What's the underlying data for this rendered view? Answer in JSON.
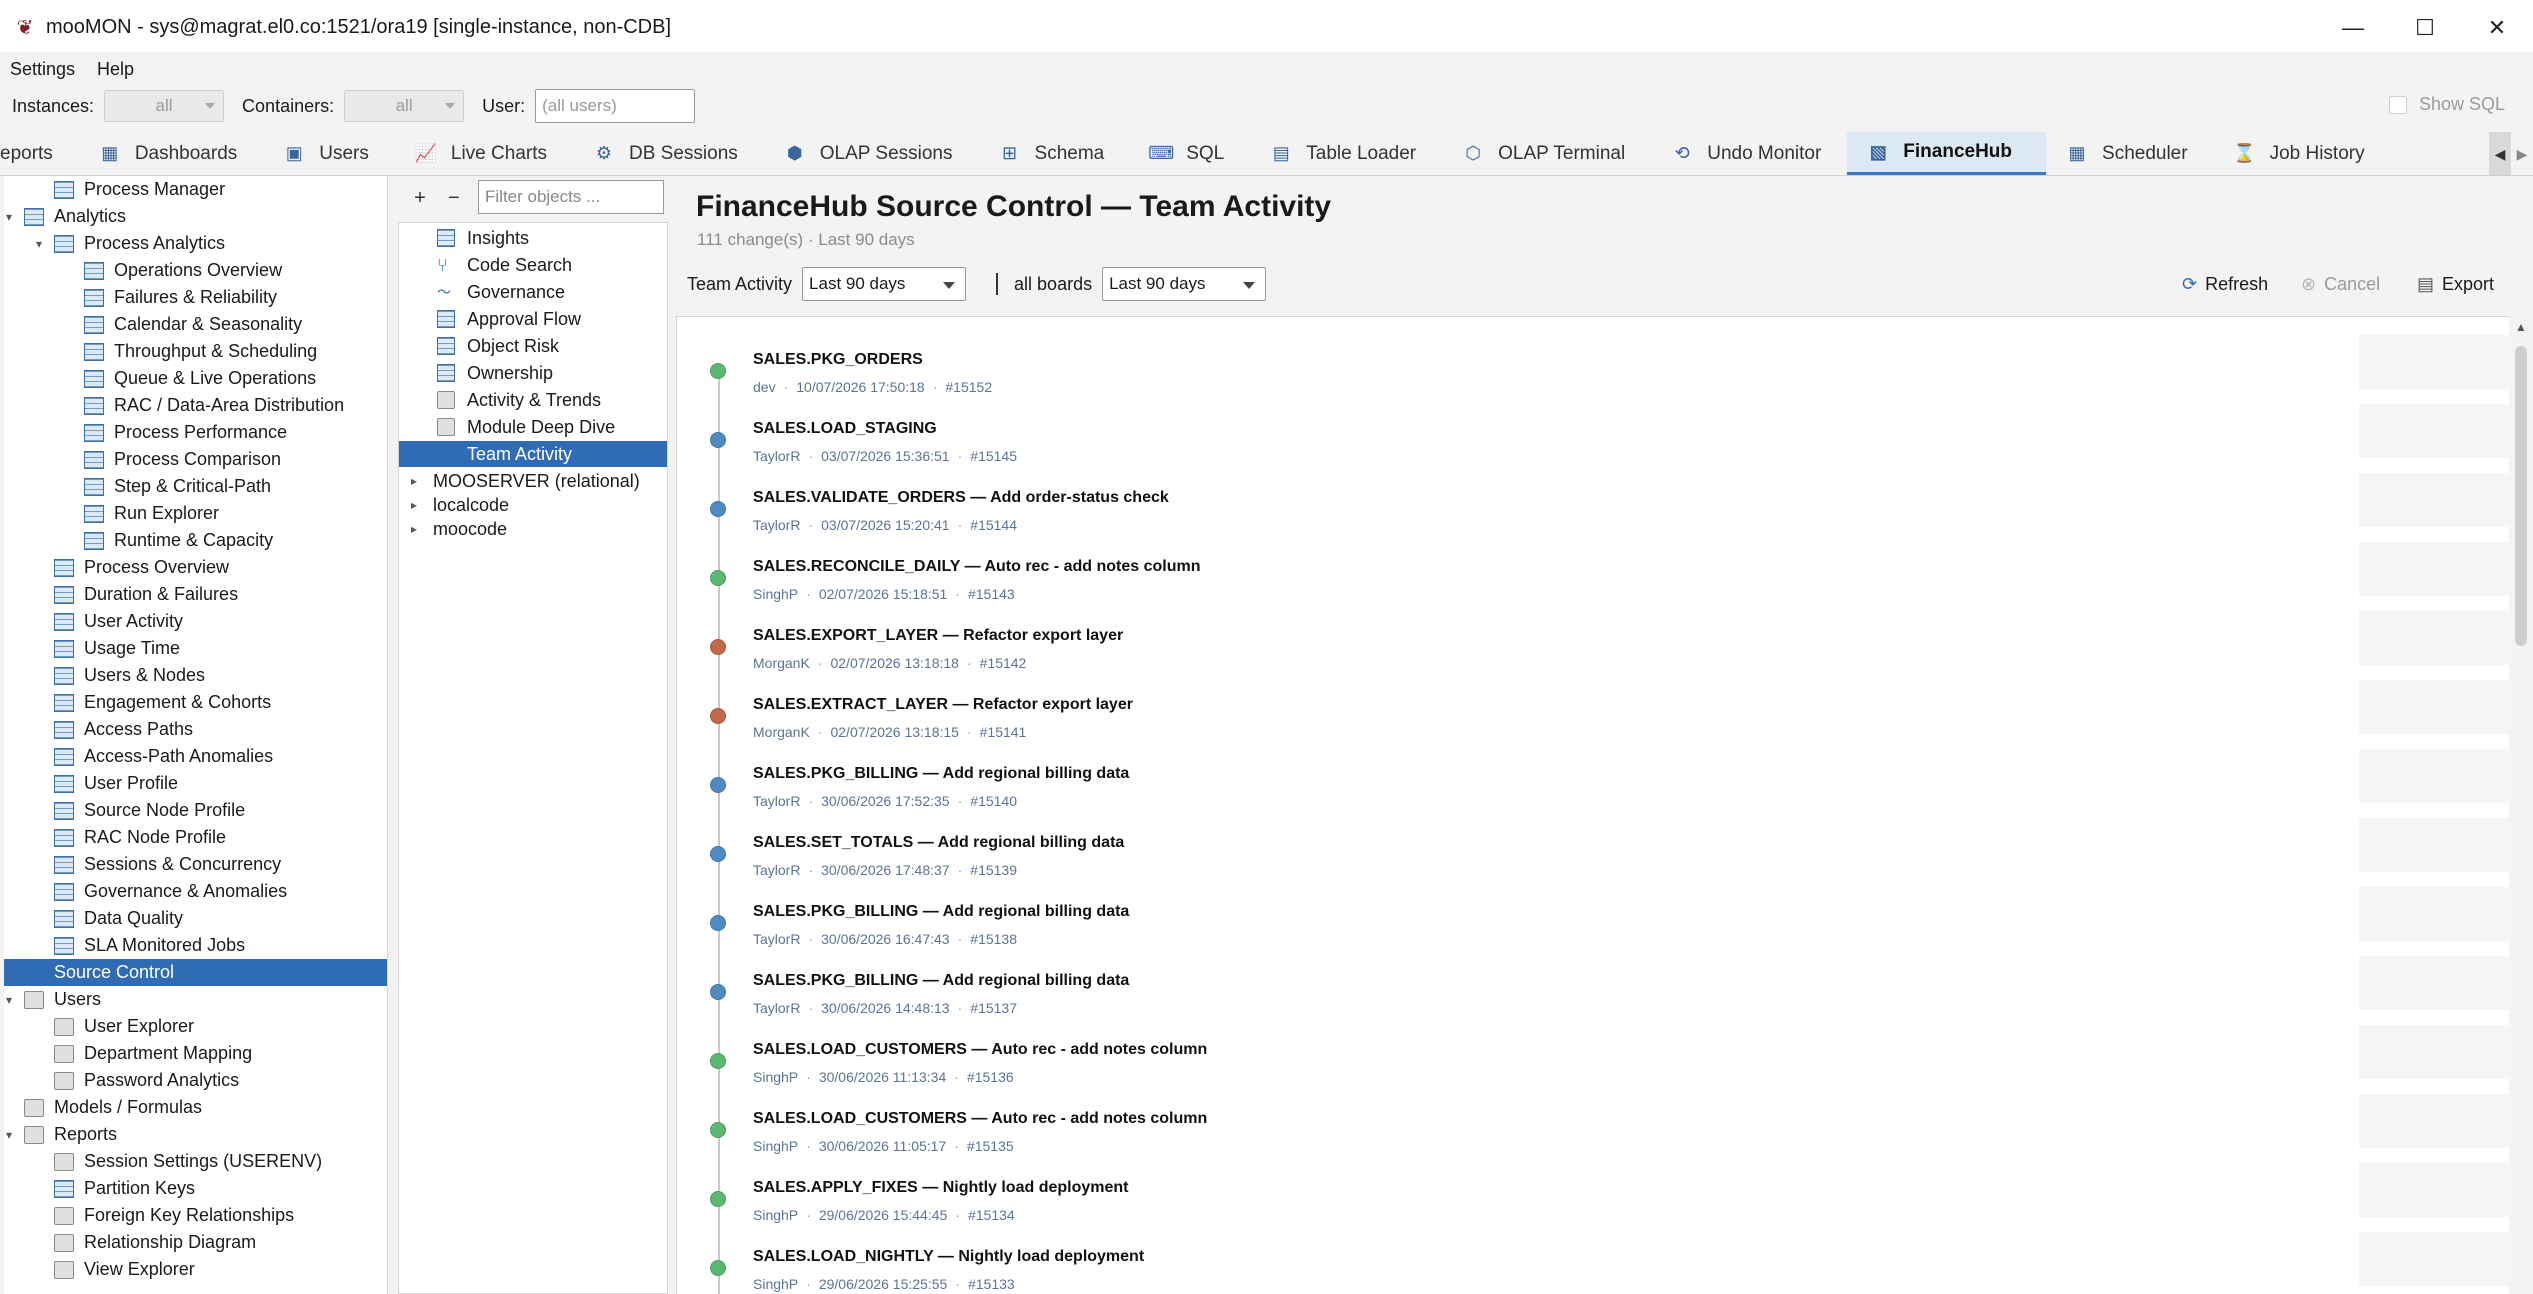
{
  "window": {
    "title": "mooMON - sys@magrat.el0.co:1521/ora19  [single-instance, non-CDB]",
    "controls": {
      "minimize": "—",
      "maximize": "☐",
      "close": "✕"
    }
  },
  "menu": {
    "settings": "Settings",
    "help": "Help"
  },
  "filters": {
    "instances_label": "Instances:",
    "instances_value": "all",
    "containers_label": "Containers:",
    "containers_value": "all",
    "user_label": "User:",
    "user_placeholder": "(all users)",
    "show_sql": "Show SQL"
  },
  "tabs": [
    {
      "label": "eports",
      "icon": ""
    },
    {
      "label": "Dashboards",
      "icon": "dashboard-icon"
    },
    {
      "label": "Users",
      "icon": "users-icon"
    },
    {
      "label": "Live Charts",
      "icon": "chart-icon"
    },
    {
      "label": "DB Sessions",
      "icon": "sessions-icon"
    },
    {
      "label": "OLAP Sessions",
      "icon": "cube-icon"
    },
    {
      "label": "Schema",
      "icon": "schema-icon"
    },
    {
      "label": "SQL",
      "icon": "sql-icon"
    },
    {
      "label": "Table Loader",
      "icon": "table-icon"
    },
    {
      "label": "OLAP Terminal",
      "icon": "terminal-icon"
    },
    {
      "label": "Undo Monitor",
      "icon": "undo-icon"
    },
    {
      "label": "FinanceHub",
      "icon": "financehub-icon",
      "active": true
    },
    {
      "label": "Scheduler",
      "icon": "calendar-icon"
    },
    {
      "label": "Job History",
      "icon": "history-icon"
    }
  ],
  "tree": [
    {
      "label": "Process Manager",
      "level": 1,
      "exp": "",
      "icon": "grid"
    },
    {
      "label": "Analytics",
      "level": 0,
      "exp": "▾",
      "icon": "grid"
    },
    {
      "label": "Process Analytics",
      "level": 1,
      "exp": "▾",
      "icon": "grid"
    },
    {
      "label": "Operations Overview",
      "level": 2,
      "exp": "",
      "icon": "grid"
    },
    {
      "label": "Failures & Reliability",
      "level": 2,
      "exp": "",
      "icon": "grid"
    },
    {
      "label": "Calendar & Seasonality",
      "level": 2,
      "exp": "",
      "icon": "grid"
    },
    {
      "label": "Throughput & Scheduling",
      "level": 2,
      "exp": "",
      "icon": "grid"
    },
    {
      "label": "Queue & Live Operations",
      "level": 2,
      "exp": "",
      "icon": "grid"
    },
    {
      "label": "RAC / Data-Area Distribution",
      "level": 2,
      "exp": "",
      "icon": "grid"
    },
    {
      "label": "Process Performance",
      "level": 2,
      "exp": "",
      "icon": "grid"
    },
    {
      "label": "Process Comparison",
      "level": 2,
      "exp": "",
      "icon": "grid"
    },
    {
      "label": "Step & Critical-Path",
      "level": 2,
      "exp": "",
      "icon": "grid"
    },
    {
      "label": "Run Explorer",
      "level": 2,
      "exp": "",
      "icon": "grid"
    },
    {
      "label": "Runtime & Capacity",
      "level": 2,
      "exp": "",
      "icon": "grid"
    },
    {
      "label": "Process Overview",
      "level": 1,
      "exp": "",
      "icon": "grid"
    },
    {
      "label": "Duration & Failures",
      "level": 1,
      "exp": "",
      "icon": "grid"
    },
    {
      "label": "User Activity",
      "level": 1,
      "exp": "",
      "icon": "grid"
    },
    {
      "label": "Usage Time",
      "level": 1,
      "exp": "",
      "icon": "grid"
    },
    {
      "label": "Users & Nodes",
      "level": 1,
      "exp": "",
      "icon": "grid"
    },
    {
      "label": "Engagement & Cohorts",
      "level": 1,
      "exp": "",
      "icon": "grid"
    },
    {
      "label": "Access Paths",
      "level": 1,
      "exp": "",
      "icon": "grid"
    },
    {
      "label": "Access-Path Anomalies",
      "level": 1,
      "exp": "",
      "icon": "grid"
    },
    {
      "label": "User Profile",
      "level": 1,
      "exp": "",
      "icon": "grid"
    },
    {
      "label": "Source Node Profile",
      "level": 1,
      "exp": "",
      "icon": "grid"
    },
    {
      "label": "RAC Node Profile",
      "level": 1,
      "exp": "",
      "icon": "grid"
    },
    {
      "label": "Sessions & Concurrency",
      "level": 1,
      "exp": "",
      "icon": "grid"
    },
    {
      "label": "Governance & Anomalies",
      "level": 1,
      "exp": "",
      "icon": "grid"
    },
    {
      "label": "Data Quality",
      "level": 1,
      "exp": "",
      "icon": "grid"
    },
    {
      "label": "SLA Monitored Jobs",
      "level": 1,
      "exp": "",
      "icon": "grid"
    },
    {
      "label": "Source Control",
      "level": 0,
      "exp": "",
      "icon": "blue",
      "selected": true
    },
    {
      "label": "Users",
      "level": 0,
      "exp": "▾",
      "icon": "gray"
    },
    {
      "label": "User Explorer",
      "level": 1,
      "exp": "",
      "icon": "gray"
    },
    {
      "label": "Department Mapping",
      "level": 1,
      "exp": "",
      "icon": "gray"
    },
    {
      "label": "Password Analytics",
      "level": 1,
      "exp": "",
      "icon": "gray"
    },
    {
      "label": "Models / Formulas",
      "level": 0,
      "exp": "",
      "icon": "gray"
    },
    {
      "label": "Reports",
      "level": 0,
      "exp": "▾",
      "icon": "gray"
    },
    {
      "label": "Session Settings (USERENV)",
      "level": 1,
      "exp": "",
      "icon": "gray"
    },
    {
      "label": "Partition Keys",
      "level": 1,
      "exp": "",
      "icon": "grid"
    },
    {
      "label": "Foreign Key Relationships",
      "level": 1,
      "exp": "",
      "icon": "gray"
    },
    {
      "label": "Relationship Diagram",
      "level": 1,
      "exp": "",
      "icon": "gray"
    },
    {
      "label": "View Explorer",
      "level": 1,
      "exp": "",
      "icon": "gray"
    }
  ],
  "objects": {
    "add": "+",
    "remove": "−",
    "filter_placeholder": "Filter objects ...",
    "items": [
      {
        "label": "Insights",
        "icon": "grid",
        "child": true
      },
      {
        "label": "Code Search",
        "icon": "branch",
        "child": true
      },
      {
        "label": "Governance",
        "icon": "wave",
        "child": true
      },
      {
        "label": "Approval Flow",
        "icon": "grid",
        "child": true
      },
      {
        "label": "Object Risk",
        "icon": "grid",
        "child": true
      },
      {
        "label": "Ownership",
        "icon": "grid",
        "child": true
      },
      {
        "label": "Activity & Trends",
        "icon": "gray",
        "child": true
      },
      {
        "label": "Module Deep Dive",
        "icon": "gray",
        "child": true
      },
      {
        "label": "Team Activity",
        "icon": "",
        "child": true,
        "selected": true
      },
      {
        "label": "MOOSERVER (relational)",
        "icon": "",
        "child": false
      },
      {
        "label": "localcode",
        "icon": "",
        "child": false
      },
      {
        "label": "moocode",
        "icon": "",
        "child": false
      }
    ]
  },
  "content": {
    "title": "FinanceHub Source Control — Team Activity",
    "subtitle": "111 change(s) · Last 90 days",
    "toolbar": {
      "team_label": "Team Activity",
      "period_value": "Last 90 days",
      "boards_label": "all boards",
      "boards_period_value": "Last 90 days",
      "refresh": "Refresh",
      "cancel": "Cancel",
      "export": "Export"
    },
    "entries": [
      {
        "head": "SALES.PKG_ORDERS",
        "user": "dev",
        "ts": "10/07/2026 17:50:18",
        "id": "#15152",
        "color": "#5bb870"
      },
      {
        "head": "SALES.LOAD_STAGING",
        "user": "TaylorR",
        "ts": "03/07/2026 15:36:51",
        "id": "#15145",
        "color": "#4f8bc0"
      },
      {
        "head": "SALES.VALIDATE_ORDERS  —  Add order-status check",
        "user": "TaylorR",
        "ts": "03/07/2026 15:20:41",
        "id": "#15144",
        "color": "#4f8bc0"
      },
      {
        "head": "SALES.RECONCILE_DAILY  —  Auto rec - add notes column",
        "user": "SinghP",
        "ts": "02/07/2026 15:18:51",
        "id": "#15143",
        "color": "#5bb870"
      },
      {
        "head": "SALES.EXPORT_LAYER  —  Refactor export layer",
        "user": "MorganK",
        "ts": "02/07/2026 13:18:18",
        "id": "#15142",
        "color": "#c1694a"
      },
      {
        "head": "SALES.EXTRACT_LAYER  —  Refactor export layer",
        "user": "MorganK",
        "ts": "02/07/2026 13:18:15",
        "id": "#15141",
        "color": "#c1694a"
      },
      {
        "head": "SALES.PKG_BILLING  —  Add regional billing data",
        "user": "TaylorR",
        "ts": "30/06/2026 17:52:35",
        "id": "#15140",
        "color": "#4f8bc0"
      },
      {
        "head": "SALES.SET_TOTALS  —  Add regional billing data",
        "user": "TaylorR",
        "ts": "30/06/2026 17:48:37",
        "id": "#15139",
        "color": "#4f8bc0"
      },
      {
        "head": "SALES.PKG_BILLING  —  Add regional billing data",
        "user": "TaylorR",
        "ts": "30/06/2026 16:47:43",
        "id": "#15138",
        "color": "#4f8bc0"
      },
      {
        "head": "SALES.PKG_BILLING  —  Add regional billing data",
        "user": "TaylorR",
        "ts": "30/06/2026 14:48:13",
        "id": "#15137",
        "color": "#4f8bc0"
      },
      {
        "head": "SALES.LOAD_CUSTOMERS  —  Auto rec - add notes column",
        "user": "SinghP",
        "ts": "30/06/2026 11:13:34",
        "id": "#15136",
        "color": "#5bb870"
      },
      {
        "head": "SALES.LOAD_CUSTOMERS  —  Auto rec - add notes column",
        "user": "SinghP",
        "ts": "30/06/2026 11:05:17",
        "id": "#15135",
        "color": "#5bb870"
      },
      {
        "head": "SALES.APPLY_FIXES  —  Nightly load deployment",
        "user": "SinghP",
        "ts": "29/06/2026 15:44:45",
        "id": "#15134",
        "color": "#5bb870"
      },
      {
        "head": "SALES.LOAD_NIGHTLY  —  Nightly load deployment",
        "user": "SinghP",
        "ts": "29/06/2026 15:25:55",
        "id": "#15133",
        "color": "#5bb870"
      }
    ]
  }
}
